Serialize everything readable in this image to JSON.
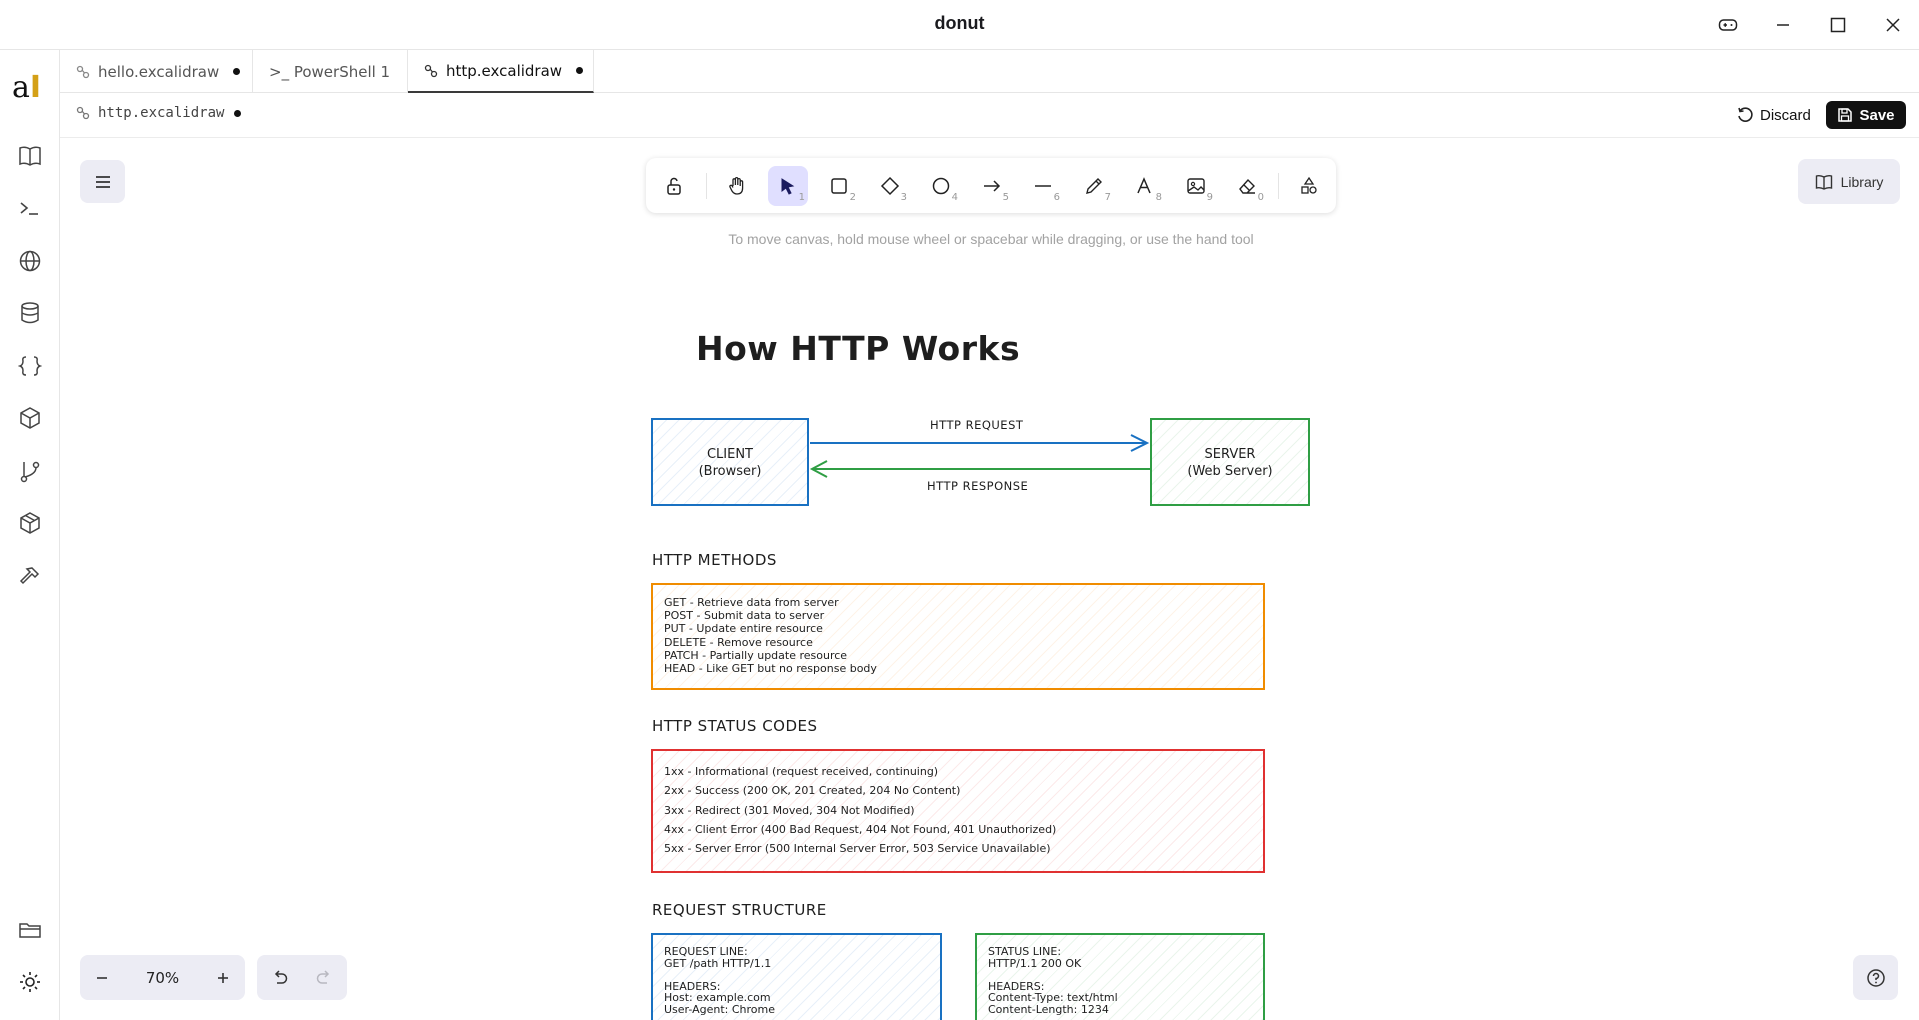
{
  "window": {
    "title": "donut"
  },
  "tabs": [
    {
      "label": "hello.excalidraw",
      "modified": true
    },
    {
      "label": ">_ PowerShell 1"
    },
    {
      "label": "http.excalidraw",
      "modified": true
    }
  ],
  "file": {
    "name": "http.excalidraw"
  },
  "actions": {
    "discard": "Discard",
    "save": "Save"
  },
  "toolbar": {
    "keys": [
      "1",
      "2",
      "3",
      "4",
      "5",
      "6",
      "7",
      "8",
      "9",
      "0"
    ],
    "library": "Library"
  },
  "hint": "To move canvas, hold mouse wheel or spacebar while dragging, or use the hand tool",
  "diagram": {
    "title": "How HTTP Works",
    "client": [
      "CLIENT",
      "(Browser)"
    ],
    "server": [
      "SERVER",
      "(Web Server)"
    ],
    "request_label": "HTTP REQUEST",
    "response_label": "HTTP RESPONSE",
    "methods_title": "HTTP METHODS",
    "methods": "GET - Retrieve data from server\nPOST - Submit data to server\nPUT - Update entire resource\nDELETE - Remove resource\nPATCH - Partially update resource\nHEAD - Like GET but no response body",
    "status_title": "HTTP STATUS CODES",
    "status": "1xx - Informational (request received, continuing)\n2xx - Success (200 OK, 201 Created, 204 No Content)\n3xx - Redirect (301 Moved, 304 Not Modified)\n4xx - Client Error (400 Bad Request, 404 Not Found, 401 Unauthorized)\n5xx - Server Error (500 Internal Server Error, 503 Service Unavailable)",
    "structure_title": "REQUEST STRUCTURE",
    "request_box": "REQUEST LINE:\nGET /path HTTP/1.1\n\nHEADERS:\nHost: example.com\nUser-Agent: Chrome",
    "response_box": "STATUS LINE:\nHTTP/1.1 200 OK\n\nHEADERS:\nContent-Type: text/html\nContent-Length: 1234"
  },
  "zoom": {
    "value": "70%"
  },
  "colors": {
    "blue": "#1971c2",
    "green": "#2f9e44",
    "orange": "#f08c00",
    "red": "#e03131",
    "accent": "#e0dfff"
  }
}
